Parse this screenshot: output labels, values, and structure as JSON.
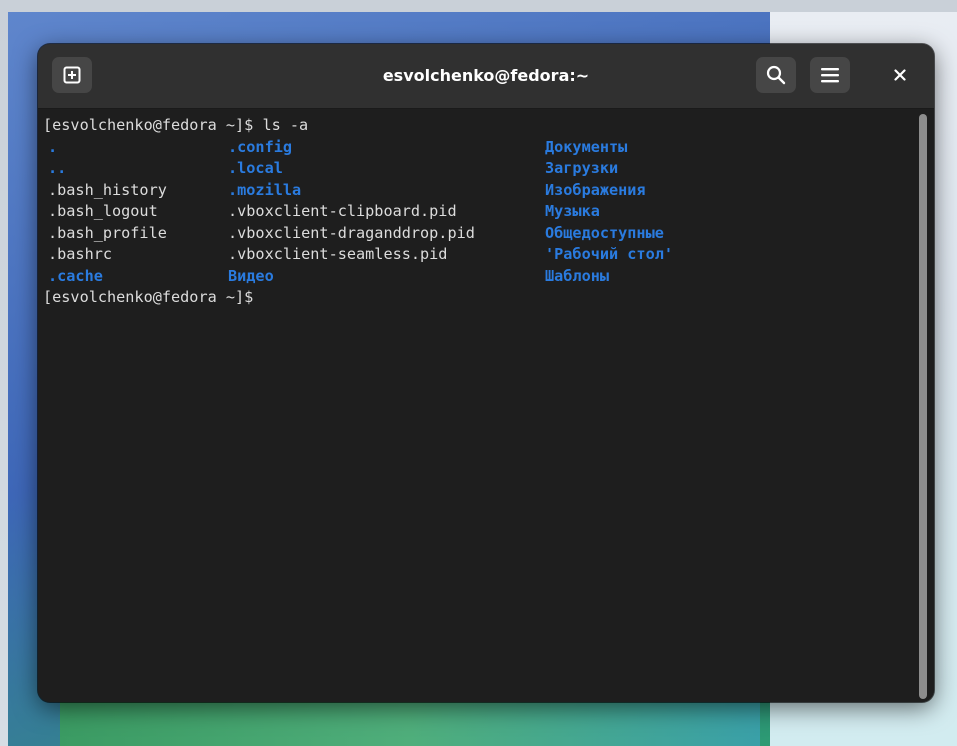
{
  "window": {
    "title": "esvolchenko@fedora:~"
  },
  "header": {
    "new_tab_icon": "new-tab-icon",
    "search_icon": "search-icon",
    "menu_icon": "hamburger-menu-icon",
    "close_icon": "close-icon"
  },
  "terminal": {
    "command_line": "[esvolchenko@fedora ~]$ ls -a",
    "rows": [
      {
        "c1": ".",
        "c1_dir": true,
        "c2": ".config",
        "c2_dir": true,
        "c3": "Документы",
        "c3_dir": true
      },
      {
        "c1": "..",
        "c1_dir": true,
        "c2": ".local",
        "c2_dir": true,
        "c3": "Загрузки",
        "c3_dir": true
      },
      {
        "c1": ".bash_history",
        "c1_dir": false,
        "c2": ".mozilla",
        "c2_dir": true,
        "c3": "Изображения",
        "c3_dir": true
      },
      {
        "c1": ".bash_logout",
        "c1_dir": false,
        "c2": ".vboxclient-clipboard.pid",
        "c2_dir": false,
        "c3": "Музыка",
        "c3_dir": true
      },
      {
        "c1": ".bash_profile",
        "c1_dir": false,
        "c2": ".vboxclient-draganddrop.pid",
        "c2_dir": false,
        "c3": "Общедоступные",
        "c3_dir": true
      },
      {
        "c1": ".bashrc",
        "c1_dir": false,
        "c2": ".vboxclient-seamless.pid",
        "c2_dir": false,
        "c3": "'Рабочий стол'",
        "c3_dir": true
      },
      {
        "c1": ".cache",
        "c1_dir": true,
        "c2": "Видео",
        "c2_dir": true,
        "c3": "Шаблоны",
        "c3_dir": true
      }
    ],
    "prompt_line": "[esvolchenko@fedora ~]$"
  },
  "colors": {
    "directory": "#2a7bdf",
    "text": "#dcdcdc",
    "background": "#1e1e1e",
    "headerbar": "#303030"
  }
}
